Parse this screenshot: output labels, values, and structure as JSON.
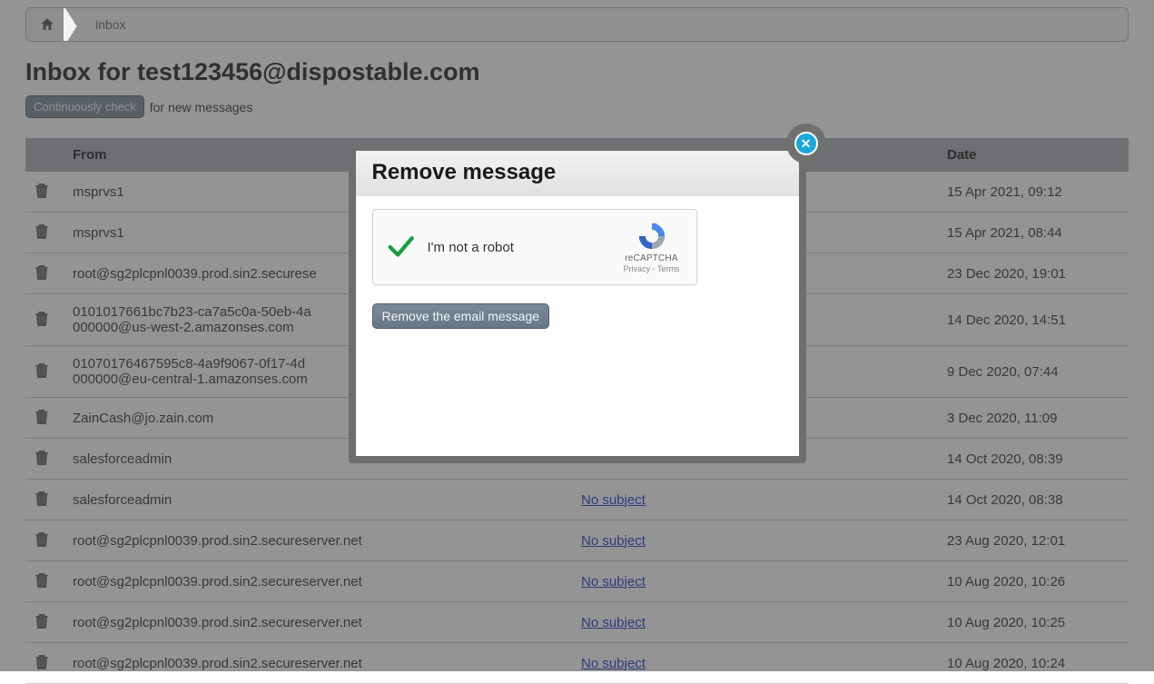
{
  "breadcrumb": {
    "item": "inbox"
  },
  "page": {
    "title": "Inbox for test123456@dispostable.com",
    "check_button": "Continuously check",
    "check_suffix": "for new messages"
  },
  "table": {
    "headers": {
      "from": "From",
      "subject": "",
      "subject_blank": "",
      "date": "Date"
    },
    "rows": [
      {
        "from": "msprvs1",
        "subject": "",
        "date": "15 Apr 2021, 09:12"
      },
      {
        "from": "msprvs1",
        "subject": "",
        "date": "15 Apr 2021, 08:44"
      },
      {
        "from": "root@sg2plcpnl0039.prod.sin2.securese",
        "subject": "",
        "date": "23 Dec 2020, 19:01"
      },
      {
        "from": "0101017661bc7b23-ca7a5c0a-50eb-4a\n000000@us-west-2.amazonses.com",
        "subject": "",
        "date": "14 Dec 2020, 14:51"
      },
      {
        "from": "01070176467595c8-4a9f9067-0f17-4d\n000000@eu-central-1.amazonses.com",
        "subject": "",
        "date": "9 Dec 2020, 07:44"
      },
      {
        "from": "ZainCash@jo.zain.com",
        "subject": "",
        "date": "3 Dec 2020, 11:09"
      },
      {
        "from": "salesforceadmin",
        "subject": "",
        "date": "14 Oct 2020, 08:39"
      },
      {
        "from": "salesforceadmin",
        "subject": "No subject",
        "date": "14 Oct 2020, 08:38"
      },
      {
        "from": "root@sg2plcpnl0039.prod.sin2.secureserver.net",
        "subject": "No subject",
        "date": "23 Aug 2020, 12:01"
      },
      {
        "from": "root@sg2plcpnl0039.prod.sin2.secureserver.net",
        "subject": "No subject",
        "date": "10 Aug 2020, 10:26"
      },
      {
        "from": "root@sg2plcpnl0039.prod.sin2.secureserver.net",
        "subject": "No subject",
        "date": "10 Aug 2020, 10:25"
      },
      {
        "from": "root@sg2plcpnl0039.prod.sin2.secureserver.net",
        "subject": "No subject",
        "date": "10 Aug 2020, 10:24"
      }
    ]
  },
  "modal": {
    "title": "Remove message",
    "captcha_label": "I'm not a robot",
    "captcha_brand": "reCAPTCHA",
    "captcha_privacy": "Privacy",
    "captcha_terms": "Terms",
    "remove_button": "Remove the email message"
  }
}
